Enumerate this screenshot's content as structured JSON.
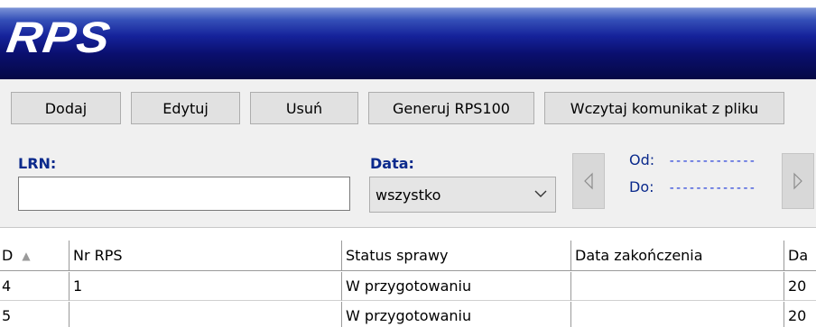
{
  "app": {
    "title": "RPS"
  },
  "toolbar": {
    "add_label": "Dodaj",
    "edit_label": "Edytuj",
    "delete_label": "Usuń",
    "generate_label": "Generuj RPS100",
    "load_label": "Wczytaj komunikat z pliku"
  },
  "filters": {
    "lrn_label": "LRN:",
    "lrn_value": "",
    "date_label": "Data:",
    "date_selected": "wszystko",
    "from_label": "Od:",
    "from_value": "-------------",
    "to_label": "Do:",
    "to_value": "-------------"
  },
  "table": {
    "headers": [
      "D",
      "Nr RPS",
      "Status sprawy",
      "Data zakończenia",
      "Da"
    ],
    "sort_indicator": "▲",
    "rows": [
      [
        "4",
        "1",
        "W przygotowaniu",
        "",
        "20"
      ],
      [
        "5",
        "",
        "W przygotowaniu",
        "",
        "20"
      ]
    ]
  }
}
